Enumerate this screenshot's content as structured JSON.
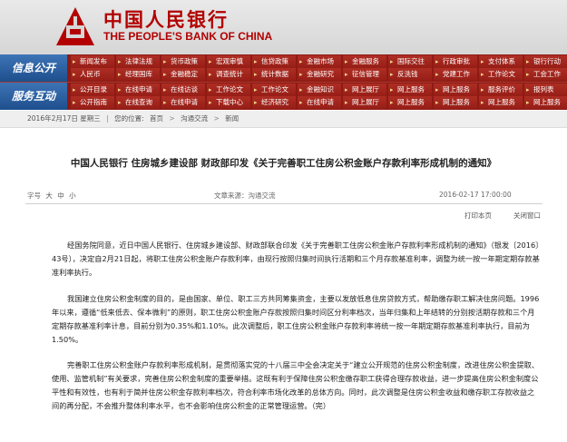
{
  "header": {
    "brand_cn": "中国人民银行",
    "brand_en": "THE PEOPLE'S BANK OF CHINA",
    "accent_color": "#b30000"
  },
  "nav": {
    "row1_title": "信息公开",
    "row1_items": [
      [
        "新闻发布",
        "人民币"
      ],
      [
        "法律法规",
        "经理国库"
      ],
      [
        "货币政策",
        "金融稳定"
      ],
      [
        "宏观审慎",
        "调查统计"
      ],
      [
        "信贷政策",
        "统计数据"
      ],
      [
        "金融市场",
        "金融研究"
      ],
      [
        "金融服务",
        "征信管理"
      ],
      [
        "国际交往",
        "反洗钱"
      ],
      [
        "行政审批",
        "党建工作"
      ],
      [
        "支付体系",
        "工作论文"
      ],
      [
        "银行行动",
        "工会工作"
      ]
    ],
    "row2_title": "服务互动",
    "row2_items": [
      [
        "公开目录",
        "公开指南"
      ],
      [
        "在线申请",
        "在线查询"
      ],
      [
        "在线访谈",
        "在线申请"
      ],
      [
        "工作论文",
        "下载中心"
      ],
      [
        "工作论文",
        "经济研究"
      ],
      [
        "金融知识",
        "在线申请"
      ],
      [
        "网上展厅",
        "网上展厅"
      ],
      [
        "网上服务",
        "网上服务"
      ],
      [
        "网上服务",
        "网上服务"
      ],
      [
        "服务评价",
        "网上服务"
      ],
      [
        "报列表",
        "网上服务"
      ]
    ],
    "nav_color": "#8e1a14",
    "title_color": "#2a5fa0"
  },
  "breadcrumb": {
    "date": "2016年2月17日 星期三",
    "location_label": "您的位置:",
    "items": [
      "首页",
      "沟通交流",
      "新闻"
    ]
  },
  "article": {
    "title": "中国人民银行 住房城乡建设部 财政部印发《关于完善职工住房公积金账户存款利率形成机制的通知》",
    "font_label": "字号",
    "font_sizes": [
      "大",
      "中",
      "小"
    ],
    "source": "文章来源：沟通交流",
    "time": "2016-02-17 17:00:00",
    "print_label": "打印本页",
    "close_label": "关闭窗口",
    "paragraphs": [
      "经国务院同意，近日中国人民银行、住房城乡建设部、财政部联合印发《关于完善职工住房公积金账户存款利率形成机制的通知》（银发〔2016〕43号），决定自2月21日起，将职工住房公积金账户存款利率，由现行按照归集时间执行活期和三个月存款基准利率，调整为统一按一年期定期存款基准利率执行。",
      "我国建立住房公积金制度的目的，是由国家、单位、职工三方共同筹集资金，主要以发放低息住房贷款方式，帮助缴存职工解决住房问题。1996年以来，遵循“低来低去、保本微利”的原则，职工住房公积金账户存款按照归集时间区分利率档次，当年归集和上年结转的分别按活期存款和三个月定期存款基准利率计息，目前分别为0.35%和1.10%。此次调整后，职工住房公积金账户存款利率将统一按一年期定期存款基准利率执行，目前为1.50%。",
      "完善职工住房公积金账户存款利率形成机制，是贯彻落实党的十八届三中全会决定关于“建立公开规范的住房公积金制度，改进住房公积金提取、使用、监管机制”有关要求，完善住房公积金制度的重要举措。这既有利于保障住房公积金缴存职工获得合理存款收益，进一步提高住房公积金制度公平性和有效性，也有利于简并住房公积金存款利率档次，符合利率市场化改革的总体方向。同时，此次调整是住房公积金收益和缴存职工存款收益之间的再分配，不会推升整体利率水平，也不会影响住房公积金的正常管理运营。（完）"
    ]
  }
}
